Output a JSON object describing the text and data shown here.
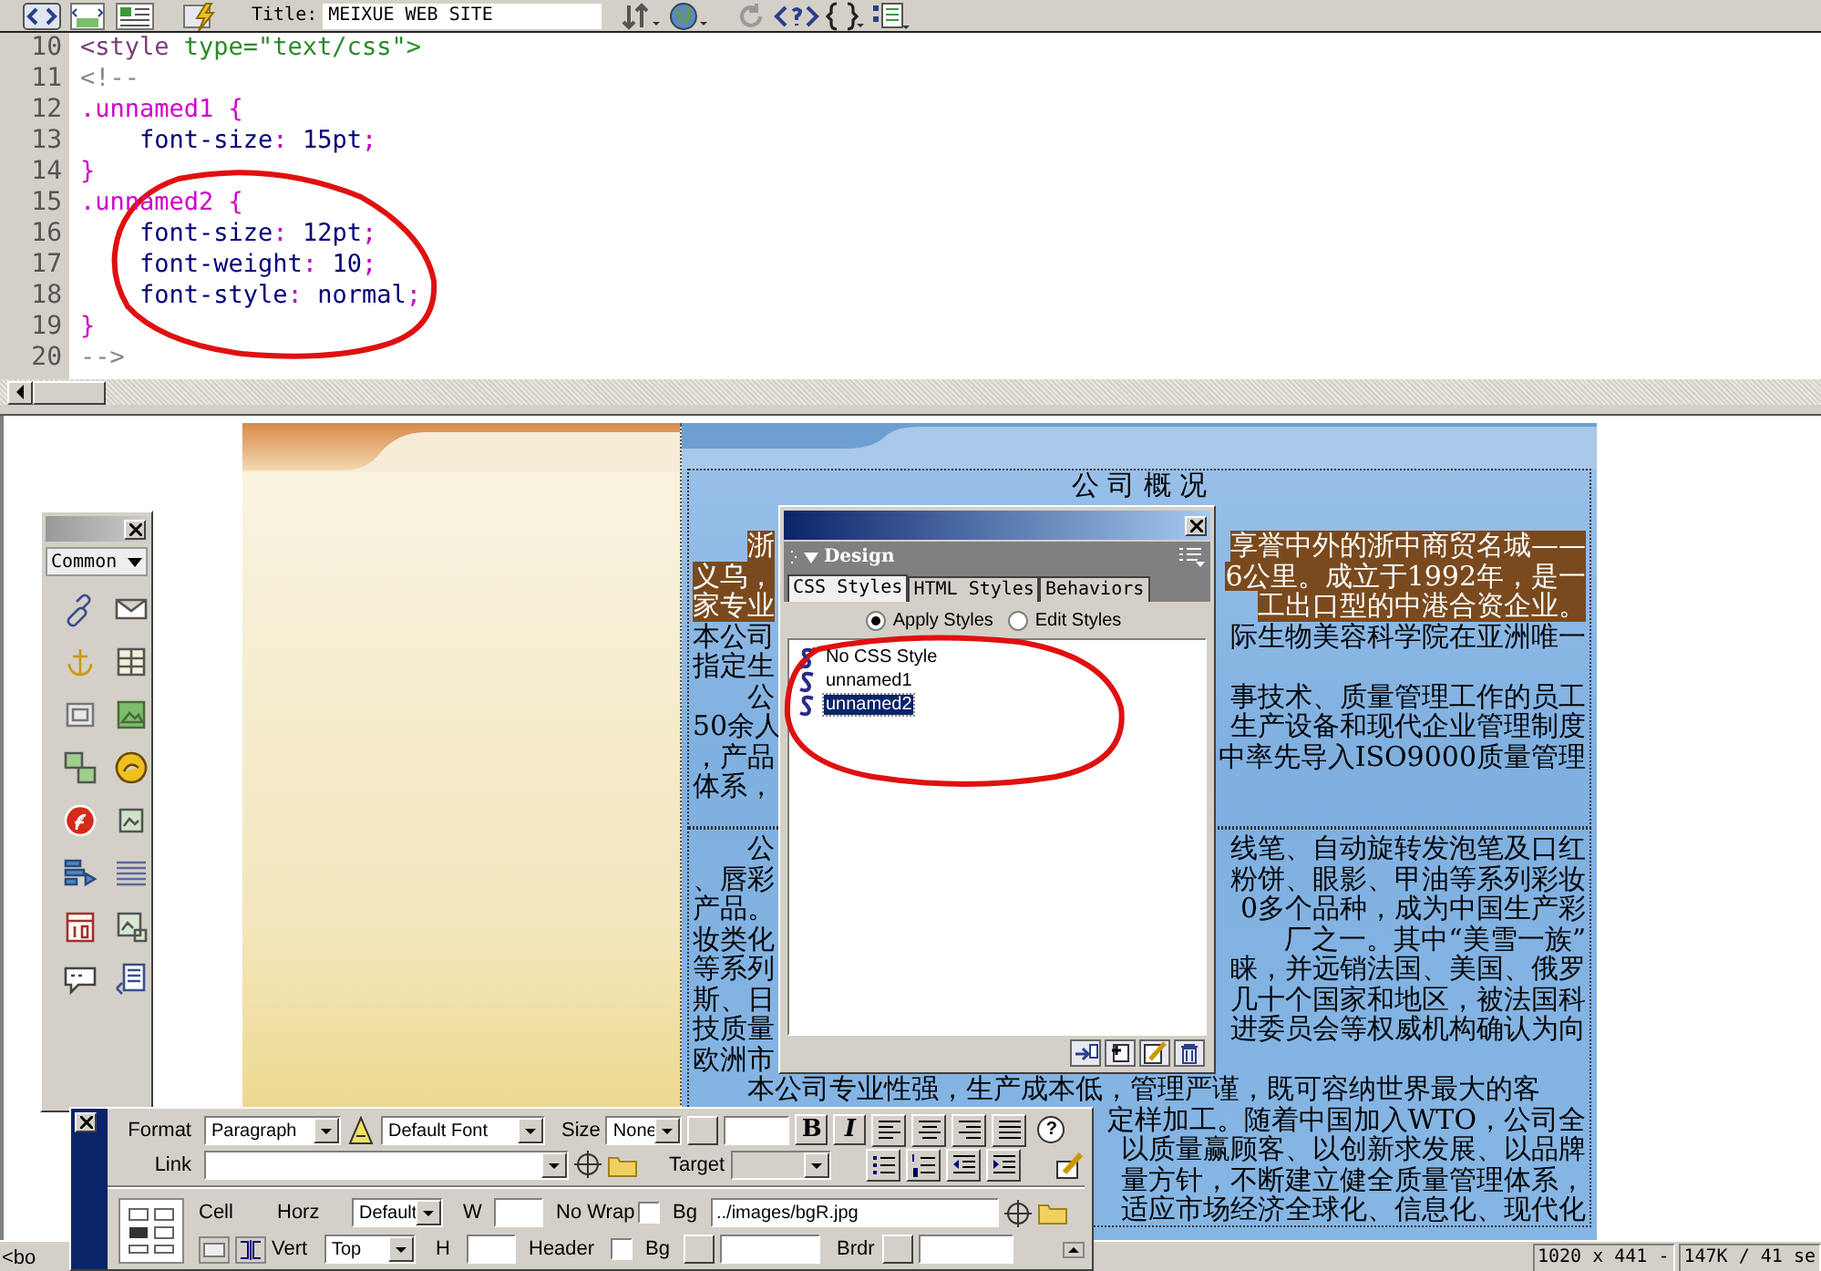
{
  "toolbar": {
    "title_label": "Title:",
    "title_value": "MEIXUE WEB SITE"
  },
  "code": {
    "lines": [
      {
        "number": "10",
        "parts": [
          {
            "kind": "tag",
            "text": "<style "
          },
          {
            "kind": "attribute",
            "text": "type=\"text/css\">"
          }
        ]
      },
      {
        "number": "11",
        "parts": [
          {
            "kind": "comment",
            "text": "<!--"
          }
        ]
      },
      {
        "number": "12",
        "parts": [
          {
            "kind": "selector",
            "text": ".unnamed1 {"
          }
        ]
      },
      {
        "number": "13",
        "parts": [
          {
            "kind": "property",
            "text": "    font-size"
          },
          {
            "kind": "punct",
            "text": ": "
          },
          {
            "kind": "value",
            "text": "15pt"
          },
          {
            "kind": "punct",
            "text": ";"
          }
        ]
      },
      {
        "number": "14",
        "parts": [
          {
            "kind": "selector",
            "text": "}"
          }
        ]
      },
      {
        "number": "15",
        "parts": [
          {
            "kind": "selector",
            "text": ".unnamed2 {"
          }
        ]
      },
      {
        "number": "16",
        "parts": [
          {
            "kind": "property",
            "text": "    font-size"
          },
          {
            "kind": "punct",
            "text": ": "
          },
          {
            "kind": "value",
            "text": "12pt"
          },
          {
            "kind": "punct",
            "text": ";"
          }
        ]
      },
      {
        "number": "17",
        "parts": [
          {
            "kind": "property",
            "text": "    font-weight"
          },
          {
            "kind": "punct",
            "text": ": "
          },
          {
            "kind": "value",
            "text": "10"
          },
          {
            "kind": "punct",
            "text": ";"
          }
        ]
      },
      {
        "number": "18",
        "parts": [
          {
            "kind": "property",
            "text": "    font-style"
          },
          {
            "kind": "punct",
            "text": ": "
          },
          {
            "kind": "value",
            "text": "normal"
          },
          {
            "kind": "punct",
            "text": ";"
          }
        ]
      },
      {
        "number": "19",
        "parts": [
          {
            "kind": "selector",
            "text": "}"
          }
        ]
      },
      {
        "number": "20",
        "parts": [
          {
            "kind": "comment",
            "text": "-->"
          }
        ]
      }
    ]
  },
  "design": {
    "heading": "公 司 概 况",
    "sections": [
      {
        "lines": [
          {
            "left": "浙",
            "right": "享誉中外的浙中商贸名城——",
            "indent": true,
            "highlighted": true
          },
          {
            "left": "义乌，",
            "right": "6公里。成立于1992年，是一",
            "indent": false,
            "highlighted": true
          },
          {
            "left": "家专业",
            "right": "工出口型的中港合资企业。",
            "indent": false,
            "highlighted": true
          },
          {
            "left": "本公司",
            "right": "际生物美容科学院在亚洲唯一",
            "indent": false,
            "highlighted": false
          },
          {
            "left": "指定生",
            "indent": false,
            "highlighted": false
          },
          {
            "left": "公",
            "right": "事技术、质量管理工作的员工",
            "indent": true,
            "highlighted": false
          },
          {
            "left": "50余人",
            "right": "生产设备和现代企业管理制度",
            "indent": false,
            "highlighted": false
          },
          {
            "left": "，产品",
            "right": "中率先导入ISO9000质量管理",
            "indent": false,
            "highlighted": false
          },
          {
            "left": "体系，",
            "indent": false,
            "highlighted": false
          }
        ]
      },
      {
        "lines": [
          {
            "left": "公",
            "right": "线笔、自动旋转发泡笔及口红",
            "indent": true,
            "highlighted": false
          },
          {
            "left": "、唇彩",
            "right": "粉饼、眼影、甲油等系列彩妆",
            "indent": false,
            "highlighted": false
          },
          {
            "left": "产品。",
            "right": "0多个品种，成为中国生产彩",
            "indent": false,
            "highlighted": false
          },
          {
            "left": "妆类化",
            "right": "厂之一。其中“美雪一族”",
            "indent": false,
            "highlighted": false
          },
          {
            "left": "等系列",
            "right": "睐，并远销法国、美国、俄罗",
            "indent": false,
            "highlighted": false
          },
          {
            "left": "斯、日",
            "right": "几十个国家和地区，被法国科",
            "indent": false,
            "highlighted": false
          },
          {
            "left": "技质量",
            "right": "进委员会等权威机构确认为向",
            "indent": false,
            "highlighted": false
          },
          {
            "left": "欧洲市",
            "indent": false,
            "highlighted": false
          },
          {
            "left": "本公司专业性强，生产成本低，管理严谨，既可容纳世界最大的客",
            "indent": true,
            "highlighted": false
          },
          {
            "right": "定样加工。随着中国加入WTO，公司全",
            "highlighted": false
          },
          {
            "right": "以质量赢顾客、以创新求发展、以品牌",
            "highlighted": false
          },
          {
            "right": "量方针，不断建立健全质量管理体系，",
            "highlighted": false
          },
          {
            "right": "适应市场经济全球化、信息化、现代化",
            "highlighted": false
          }
        ]
      }
    ]
  },
  "css_panel": {
    "group": "Design",
    "tabs": [
      {
        "label": "CSS Styles",
        "selected": true
      },
      {
        "label": "HTML Styles",
        "selected": false
      },
      {
        "label": "Behaviors",
        "selected": false
      }
    ],
    "modes": [
      {
        "label": "Apply Styles",
        "selected": true
      },
      {
        "label": "Edit Styles",
        "selected": false
      }
    ],
    "styles": [
      {
        "label": "No CSS Style",
        "kind": "none",
        "selected": false
      },
      {
        "label": "unnamed1",
        "kind": "class",
        "selected": false
      },
      {
        "label": "unnamed2",
        "kind": "class",
        "selected": true
      }
    ]
  },
  "insert_panel": {
    "category": "Common"
  },
  "properties": {
    "format_label": "Format",
    "format": "Paragraph",
    "font": "Default Font",
    "size_label": "Size",
    "size": "None",
    "bold": "B",
    "italic": "I",
    "help": "?",
    "link_label": "Link",
    "target_label": "Target",
    "target_disabled": true,
    "cell_label": "Cell",
    "horz_label": "Horz",
    "horz": "Default",
    "w_label": "W",
    "nowrap_label": "No Wrap",
    "nowrap_checked": false,
    "bg_label": "Bg",
    "bg_value": "../images/bgR.jpg",
    "vert_label": "Vert",
    "vert": "Top",
    "h_label": "H",
    "header_label": "Header",
    "header_checked": false,
    "bg2_label": "Bg",
    "brdr_label": "Brdr"
  },
  "status_bar": {
    "tag": "<bo",
    "dimensions": "1020 x 441 -",
    "download": "147K / 41 se"
  }
}
